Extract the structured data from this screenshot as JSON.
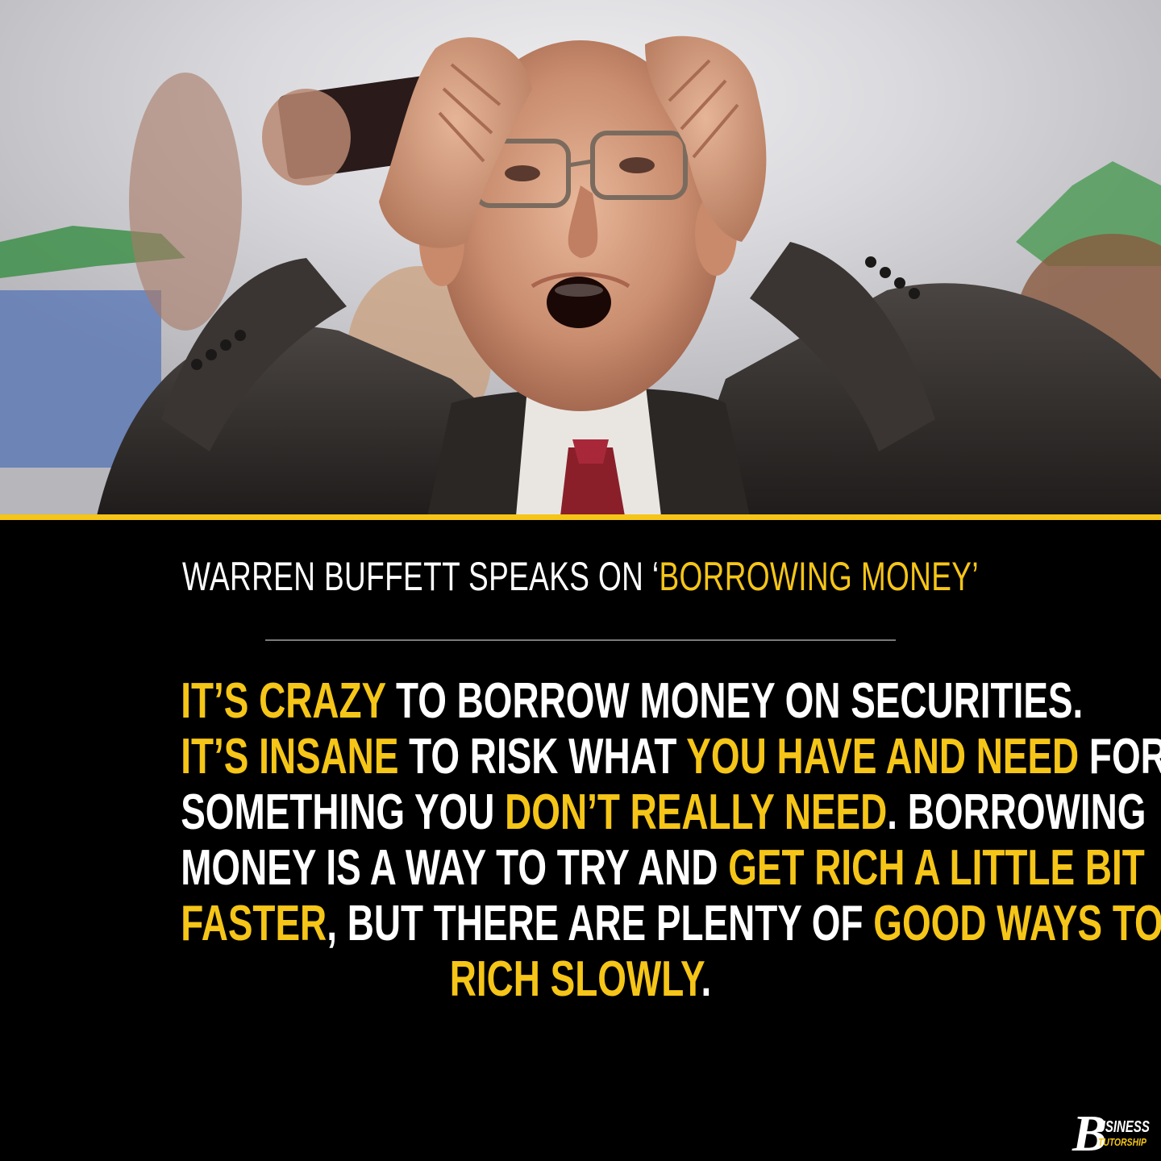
{
  "photo": {
    "description_icon": "man-holding-head-photo"
  },
  "headline": {
    "white": "WARREN BUFFETT SPEAKS ON ‘",
    "highlight": "BORROWING MONEY",
    "end": "’"
  },
  "quote": {
    "lines": [
      [
        {
          "t": "IT’S CRAZY",
          "hl": true
        },
        {
          "t": " TO BORROW MONEY ON SECURITIES.",
          "hl": false
        }
      ],
      [
        {
          "t": "IT’S INSANE",
          "hl": true
        },
        {
          "t": " TO RISK WHAT ",
          "hl": false
        },
        {
          "t": "YOU HAVE AND NEED",
          "hl": true
        },
        {
          "t": " FOR",
          "hl": false
        }
      ],
      [
        {
          "t": "SOMETHING YOU ",
          "hl": false
        },
        {
          "t": "DON’T REALLY NEED",
          "hl": true
        },
        {
          "t": ". BORROWING",
          "hl": false
        }
      ],
      [
        {
          "t": "MONEY IS A WAY TO TRY AND ",
          "hl": false
        },
        {
          "t": "GET RICH A LITTLE BIT",
          "hl": true
        }
      ],
      [
        {
          "t": "FASTER",
          "hl": true
        },
        {
          "t": ", BUT THERE ARE PLENTY OF ",
          "hl": false
        },
        {
          "t": "GOOD WAYS TO GET",
          "hl": true
        }
      ],
      [
        {
          "t": "RICH SLOWLY",
          "hl": true
        },
        {
          "t": ".",
          "hl": false
        }
      ]
    ]
  },
  "logo": {
    "initial": "B",
    "top": "USINESS",
    "bottom": "TUTORSHIP"
  },
  "colors": {
    "accent": "#f5c518",
    "text": "#ffffff",
    "background": "#000000"
  }
}
